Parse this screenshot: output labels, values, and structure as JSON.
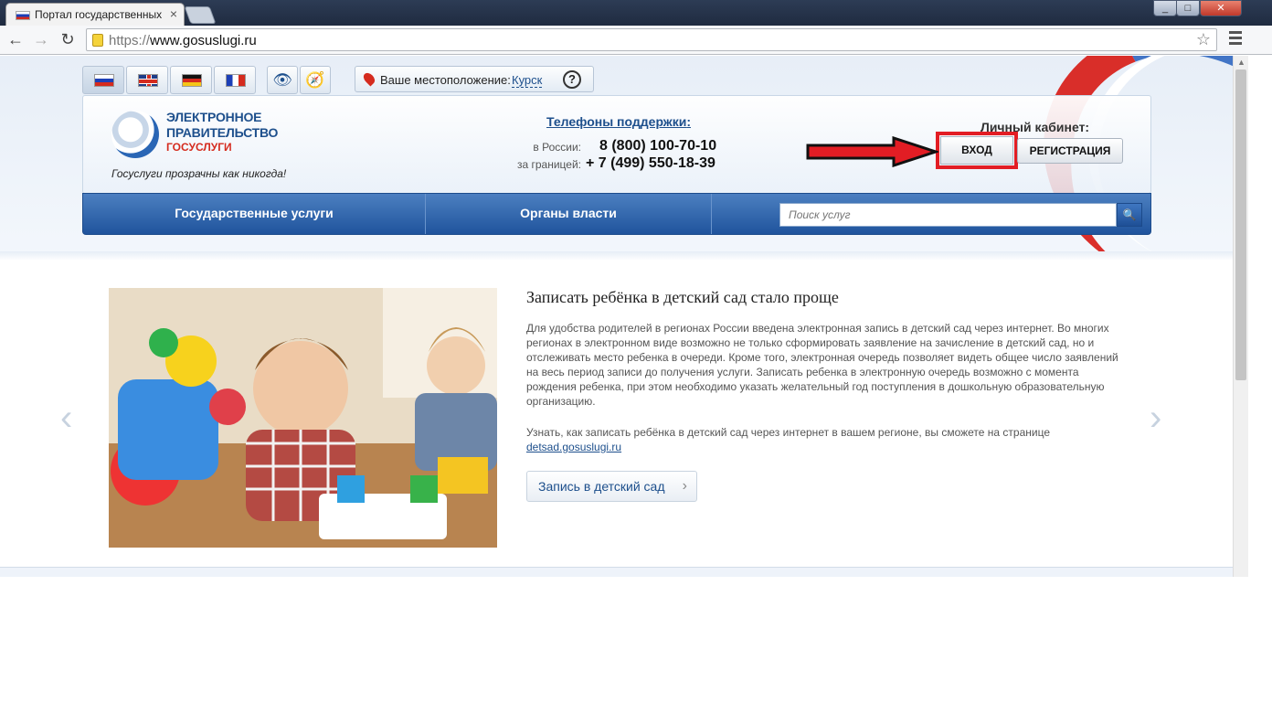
{
  "browser": {
    "tab_title": "Портал государственных",
    "tab_close": "×",
    "url_protocol": "https://",
    "url_host": "www.gosuslugi.ru",
    "win_min": "_",
    "win_max": "□",
    "win_close": "✕"
  },
  "icons": {
    "back": "arrow-left-icon",
    "forward": "arrow-right-icon",
    "reload": "reload-icon",
    "bookmark": "star-icon",
    "menu": "hamburger-icon",
    "eye": "eye-icon",
    "compass": "compass-icon",
    "pin": "location-pin-icon",
    "search": "search-icon"
  },
  "glyphs": {
    "back": "←",
    "forward": "→",
    "reload": "↻",
    "star": "☆",
    "eye": "👁",
    "compass": "🧭",
    "help": "?",
    "search": "🔍",
    "prev": "‹",
    "next": "›",
    "chevron": "›"
  },
  "location": {
    "label": "Ваше местоположение:",
    "city": "Курск",
    "help_label": "?"
  },
  "logo": {
    "line1": "ЭЛЕКТРОННОЕ",
    "line2": "ПРАВИТЕЛЬСТВО",
    "line3": "ГОСУСЛУГИ",
    "slogan": "Госуслуги прозрачны как никогда!"
  },
  "phones": {
    "title": "Телефоны поддержки",
    "colon": ":",
    "russia_label": "в России:",
    "russia_number": "8 (800) 100-70-10",
    "abroad_label": "за границей:",
    "abroad_number": "+ 7 (499) 550-18-39"
  },
  "cabinet": {
    "title": "Личный кабинет:",
    "login": "ВХОД",
    "register": "РЕГИСТРАЦИЯ"
  },
  "nav": {
    "items": [
      "Государственные услуги",
      "Органы власти"
    ],
    "search_placeholder": "Поиск услуг"
  },
  "news": {
    "title": "Записать ребёнка в детский сад стало проще",
    "body": "Для удобства родителей в регионах России введена электронная запись в детский сад через интернет. Во многих регионах в электронном виде возможно не только сформировать заявление на зачисление в детский сад, но и отслеживать место ребенка в очереди. Кроме того, электронная очередь позволяет видеть общее число заявлений на весь период записи до получения услуги. Записать ребенка в электронную очередь возможно с момента рождения ребенка, при этом необходимо указать желательный год поступления в дошкольную образовательную организацию.",
    "more_text": "Узнать, как записать ребёнка в детский сад через интернет в вашем регионе, вы сможете на странице",
    "more_link": "detsad.gosuslugi.ru",
    "button": "Запись в детский сад"
  },
  "colors": {
    "brand_blue": "#1d4f8c",
    "brand_red": "#d52b1e",
    "highlight_red": "#e21d24"
  }
}
